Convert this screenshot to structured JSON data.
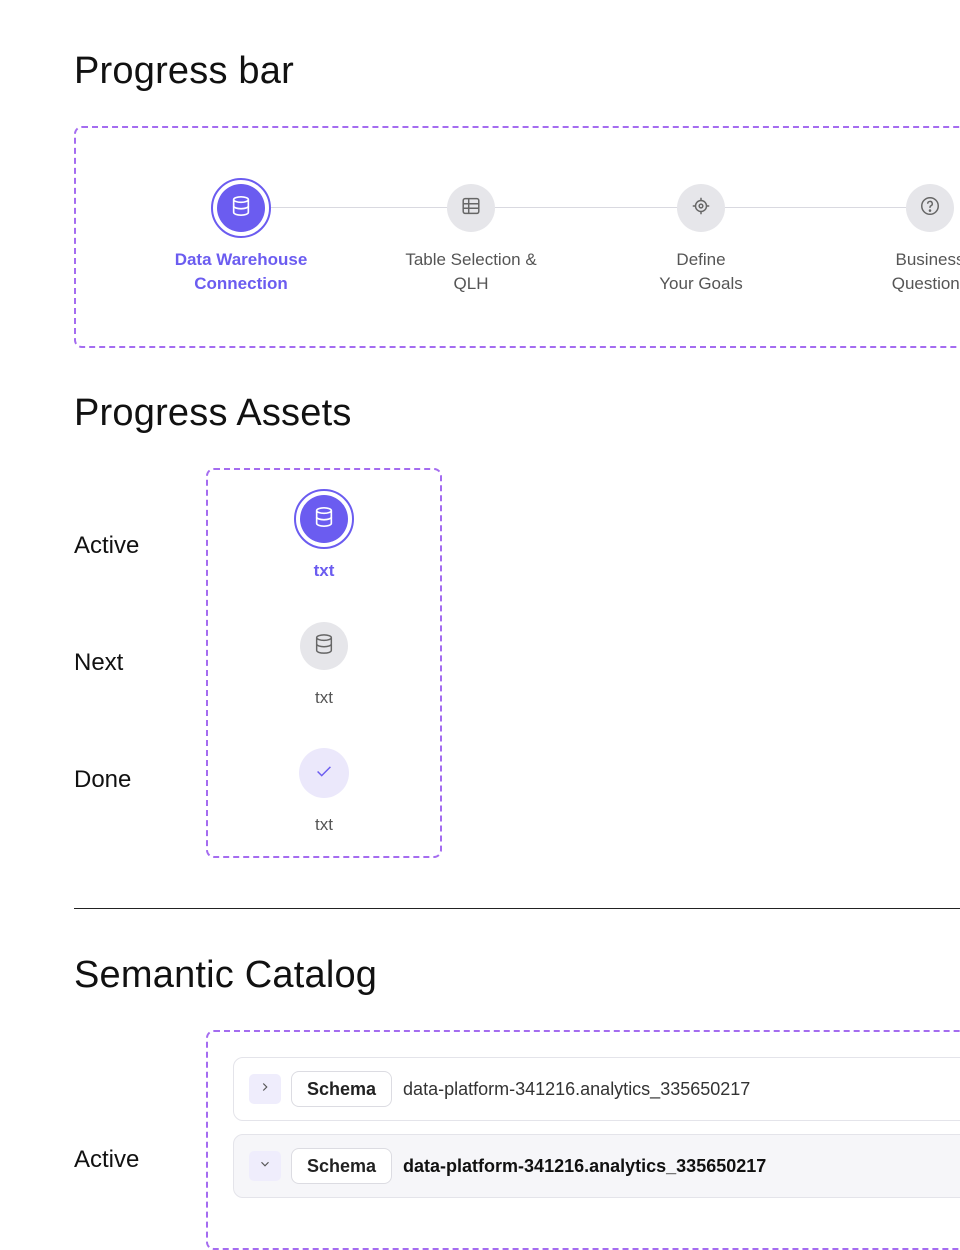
{
  "progress_bar": {
    "title": "Progress bar",
    "steps": [
      {
        "label": "Data Warehouse\nConnection",
        "icon": "database-icon",
        "state": "active"
      },
      {
        "label": "Table Selection &\nQLH",
        "icon": "table-icon",
        "state": "next"
      },
      {
        "label": "Define\nYour Goals",
        "icon": "target-icon",
        "state": "next"
      },
      {
        "label": "Business\nQuestions",
        "icon": "question-icon",
        "state": "next"
      }
    ]
  },
  "progress_assets": {
    "title": "Progress Assets",
    "rows": [
      {
        "label": "Active",
        "txt": "txt",
        "icon": "database-icon"
      },
      {
        "label": "Next",
        "txt": "txt",
        "icon": "database-icon"
      },
      {
        "label": "Done",
        "txt": "txt",
        "icon": "check-icon"
      }
    ]
  },
  "semantic_catalog": {
    "title": "Semantic Catalog",
    "active_label": "Active",
    "rows": [
      {
        "tag": "Schema",
        "name": "data-platform-341216.analytics_335650217",
        "chevron": "chevron-right-icon"
      },
      {
        "tag": "Schema",
        "name": "data-platform-341216.analytics_335650217",
        "chevron": "chevron-down-icon"
      }
    ]
  },
  "colors": {
    "accent": "#6b5cf0",
    "dashed_border": "#a46cf0",
    "inactive_circle": "#e6e6ea",
    "done_circle": "#ebe8fb"
  }
}
